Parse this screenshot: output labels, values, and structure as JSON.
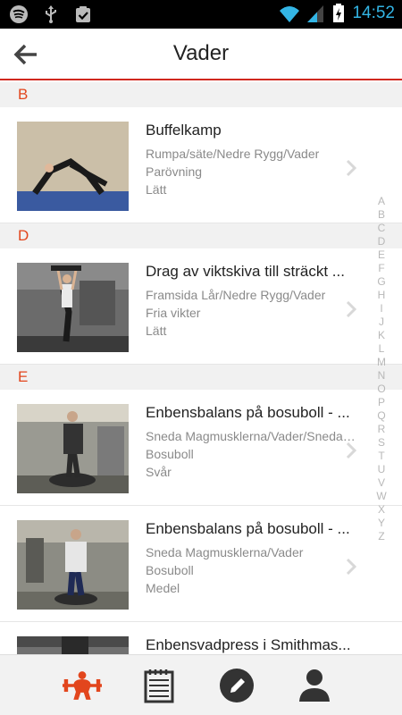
{
  "status_bar": {
    "time": "14:52",
    "left_icons": [
      "spotify-icon",
      "usb-icon",
      "clipboard-check-icon"
    ],
    "right_icons": [
      "wifi-icon",
      "signal-icon",
      "battery-icon"
    ]
  },
  "header": {
    "title": "Vader"
  },
  "sections": [
    {
      "letter": "B",
      "items": [
        {
          "title": "Buffelkamp",
          "muscles": "Rumpa/säte/Nedre Rygg/Vader",
          "equipment": "Parövning",
          "level": "Lätt"
        }
      ]
    },
    {
      "letter": "D",
      "items": [
        {
          "title": "Drag av viktskiva till sträckt ...",
          "muscles": "Framsida Lår/Nedre Rygg/Vader",
          "equipment": "Fria vikter",
          "level": "Lätt"
        }
      ]
    },
    {
      "letter": "E",
      "items": [
        {
          "title": "Enbensbalans på bosuboll - ...",
          "muscles": "Sneda Magmusklerna/Vader/Sneda ...",
          "equipment": "Bosuboll",
          "level": "Svår"
        },
        {
          "title": "Enbensbalans på bosuboll - ...",
          "muscles": "Sneda Magmusklerna/Vader",
          "equipment": "Bosuboll",
          "level": "Medel"
        },
        {
          "title": "Enbensvadpress i Smithmas...",
          "muscles": "",
          "equipment": "",
          "level": ""
        }
      ]
    }
  ],
  "alphabet_index": [
    "A",
    "B",
    "C",
    "D",
    "E",
    "F",
    "G",
    "H",
    "I",
    "J",
    "K",
    "L",
    "M",
    "N",
    "O",
    "P",
    "Q",
    "R",
    "S",
    "T",
    "U",
    "V",
    "W",
    "X",
    "Y",
    "Z"
  ],
  "bottom_nav": [
    "exercises-tab-icon",
    "workout-log-tab-icon",
    "edit-tab-icon",
    "profile-tab-icon"
  ],
  "colors": {
    "accent": "#e2461d",
    "header_line": "#d0281e",
    "clock": "#33b5e5"
  }
}
